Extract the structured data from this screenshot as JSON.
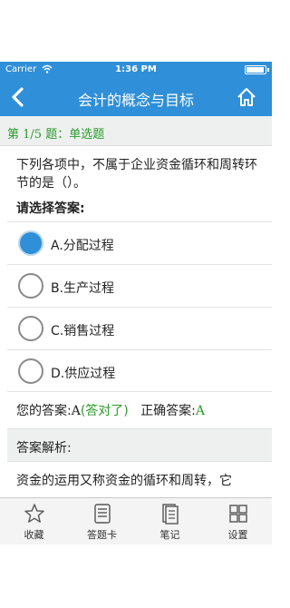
{
  "status_bar": {
    "carrier": "Carrier",
    "time": "1:36 PM"
  },
  "nav": {
    "title": "会计的概念与目标"
  },
  "question": {
    "header_prefix": "第 ",
    "header_index": "1/5",
    "header_suffix": " 题：单选题",
    "text": "下列各项中，不属于企业资金循环和周转环节的是（）。",
    "prompt": "请选择答案:"
  },
  "options": [
    {
      "label": "A.分配过程",
      "selected": true
    },
    {
      "label": "B.生产过程",
      "selected": false
    },
    {
      "label": "C.销售过程",
      "selected": false
    },
    {
      "label": "D.供应过程",
      "selected": false
    }
  ],
  "answer": {
    "your_label": "您的答案:",
    "your_value": "A",
    "verdict": "(答对了)",
    "correct_label": "正确答案:",
    "correct_value": "A"
  },
  "analysis": {
    "header": "答案解析:",
    "text": "资金的运用又称资金的循环和周转，它"
  },
  "tab_bar": {
    "items": [
      {
        "label": "收藏",
        "icon": "star-icon"
      },
      {
        "label": "答题卡",
        "icon": "answer-card-icon"
      },
      {
        "label": "笔记",
        "icon": "notes-icon"
      },
      {
        "label": "设置",
        "icon": "settings-grid-icon"
      }
    ]
  },
  "colors": {
    "accent": "#2f8fd8",
    "correct": "#2a9a2a"
  }
}
